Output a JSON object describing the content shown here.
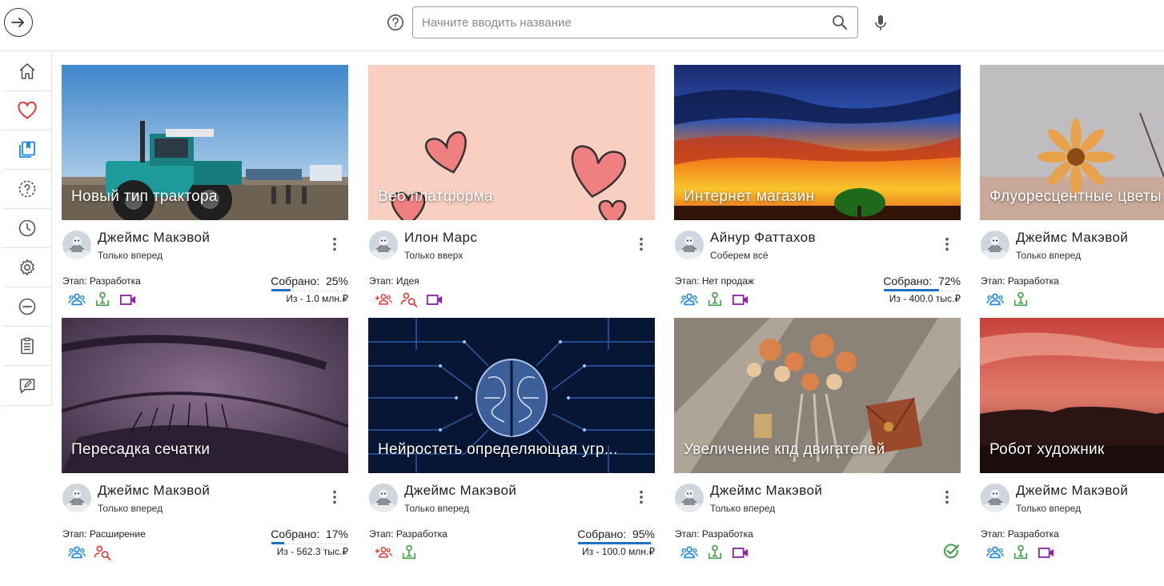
{
  "search": {
    "placeholder": "Начните вводить название"
  },
  "sidebar": {
    "items": [
      "home-icon",
      "favorites-icon",
      "bookmarks-icon",
      "questions-icon",
      "history-icon",
      "settings-icon",
      "minus-icon",
      "clipboard-icon",
      "feedback-icon"
    ]
  },
  "colors": {
    "favorite": "#e53935",
    "bookmark": "#1e88e5",
    "team": "#1e88e5",
    "mentor": "#43a047",
    "video": "#8e24aa",
    "needed": "#e53935",
    "progress": "#1e73c6"
  },
  "cards": [
    {
      "title": "Новый тип трактора",
      "author": "Джеймс Макэвой",
      "motto": "Только вперед",
      "stage_label": "Этап:",
      "stage": "Разработка",
      "raised_label": "Собрано:",
      "raised_percent": "25%",
      "progress": 0.25,
      "goal": "Из - 1.0 млн.₽",
      "badges": [
        "team-icon",
        "mentor-icon",
        "video-icon"
      ]
    },
    {
      "title": "Веб платформа",
      "author": "Илон Марс",
      "motto": "Только вверх",
      "stage_label": "Этап:",
      "stage": "Идея",
      "badges": [
        "add-team-icon",
        "search-person-icon",
        "video-icon"
      ]
    },
    {
      "title": "Интернет магазин",
      "author": "Айнур Фаттахов",
      "motto": "Соберем всё",
      "stage_label": "Этап:",
      "stage": "Нет продаж",
      "raised_label": "Собрано:",
      "raised_percent": "72%",
      "progress": 0.72,
      "goal": "Из - 400.0 тыс.₽",
      "badges": [
        "team-icon",
        "mentor-icon",
        "video-icon"
      ]
    },
    {
      "title": "Флуоресцентные цветы",
      "author": "Джеймс Макэвой",
      "motto": "Только вперед",
      "stage_label": "Этап:",
      "stage": "Разработка",
      "badges": [
        "team-icon",
        "mentor-icon"
      ]
    },
    {
      "title": "Пересадка сечатки",
      "author": "Джеймс Макэвой",
      "motto": "Только вперед",
      "stage_label": "Этап:",
      "stage": "Расширение",
      "raised_label": "Собрано:",
      "raised_percent": "17%",
      "progress": 0.17,
      "goal": "Из - 562.3 тыс.₽",
      "badges": [
        "team-icon",
        "search-person-icon"
      ]
    },
    {
      "title": "Нейростеть определяющая угр...",
      "author": "Джеймс Макэвой",
      "motto": "Только вперед",
      "stage_label": "Этап:",
      "stage": "Разработка",
      "raised_label": "Собрано:",
      "raised_percent": "95%",
      "progress": 0.95,
      "goal": "Из - 100.0 млн.₽",
      "badges": [
        "add-team-icon",
        "mentor-icon"
      ]
    },
    {
      "title": "Увеличение кпд двигателей",
      "author": "Джеймс Макэвой",
      "motto": "Только вперед",
      "stage_label": "Этап:",
      "stage": "Разработка",
      "badges": [
        "team-icon",
        "mentor-icon",
        "video-icon"
      ],
      "completed": true
    },
    {
      "title": "Робот художник",
      "author": "Джеймс Макэвой",
      "motto": "Только вперед",
      "stage_label": "Этап:",
      "stage": "Разработка",
      "badges": [
        "team-icon",
        "mentor-icon",
        "video-icon"
      ]
    }
  ]
}
